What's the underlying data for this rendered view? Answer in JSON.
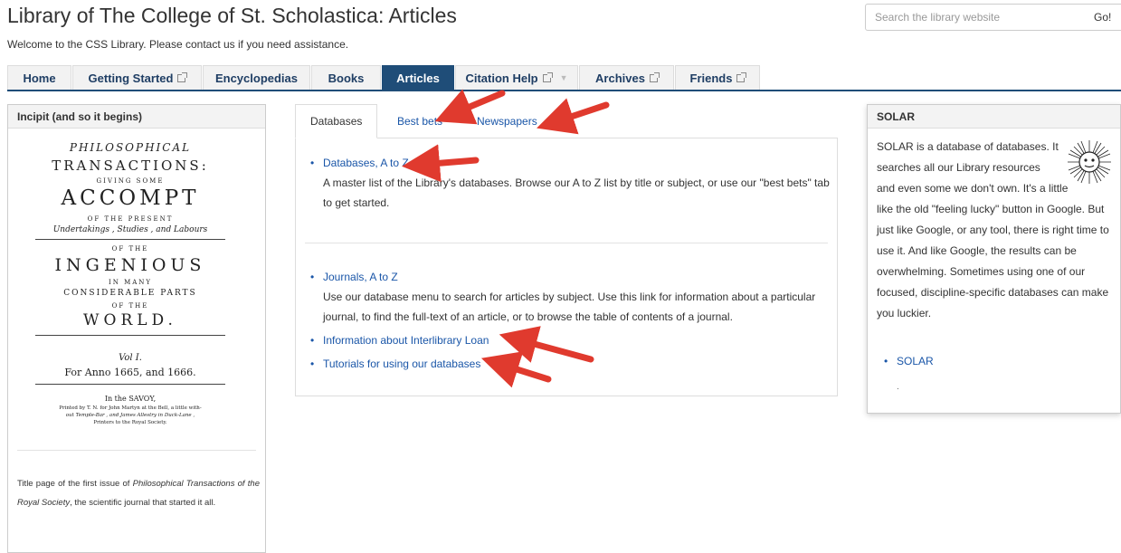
{
  "header": {
    "title": "Library of The College of St. Scholastica: Articles",
    "welcome": "Welcome to the CSS Library. Please contact us if you need assistance.",
    "search_placeholder": "Search the library website",
    "go_label": "Go!"
  },
  "nav": {
    "tabs": [
      {
        "label": "Home"
      },
      {
        "label": "Getting Started"
      },
      {
        "label": "Encyclopedias"
      },
      {
        "label": "Books"
      },
      {
        "label": "Articles"
      },
      {
        "label": "Citation Help"
      },
      {
        "label": "Archives"
      },
      {
        "label": "Friends"
      }
    ],
    "active": "Articles"
  },
  "left": {
    "title": "Incipit (and so it begins)",
    "title_page": {
      "l1": "PHILOSOPHICAL",
      "l2": "TRANSACTIONS:",
      "l3": "GIVING SOME",
      "l4": "ACCOMPT",
      "l5": "OF THE PRESENT",
      "l6": "Undertakings , Studies , and Labours",
      "l7": "OF THE",
      "l8": "INGENIOUS",
      "l9": "IN MANY",
      "l10": "CONSIDERABLE PARTS",
      "l11": "OF THE",
      "l12": "WORLD.",
      "l13": "Vol I.",
      "l14": "For Anno 1665, and 1666.",
      "l15": "In the SAVOY,",
      "l16": "Printed by T. N. for John Martyn at the Bell, a little with-",
      "l17": "out Temple-Bar , and James Allestry in Duck-Lane ,",
      "l18": "Printers to the Royal Society."
    },
    "caption_pre": "Title page of the first issue of ",
    "caption_em": "Philosophical Transactions of the Royal Society",
    "caption_post": ", the scientific journal that started it all."
  },
  "center": {
    "tabs": [
      "Databases",
      "Best bets",
      "Newspapers"
    ],
    "section1": {
      "link": "Databases, A to Z",
      "desc": "A master list of the Library's databases. Browse our A to Z list by title or subject, or use our \"best bets\" tab to get started."
    },
    "section2": {
      "link1": "Journals, A to Z",
      "desc1": "Use our database menu to search for articles by subject. Use this link for information about a particular journal, to find the full-text of an article, or to browse the table of contents of a journal.",
      "link2": "Information about Interlibrary Loan",
      "link3": "Tutorials for using our databases"
    }
  },
  "right": {
    "title": "SOLAR",
    "text": "SOLAR is a database of databases. It searches all our Library resources and even some we don't own. It's a little like the old \"feeling lucky\" button in Google. But just like Google, or any tool, there is right time to use it. And like Google, the results can be overwhelming. Sometimes using one of our focused, discipline-specific databases can make you luckier.",
    "link": "SOLAR",
    "dot": "."
  },
  "colors": {
    "nav_active": "#1f4d78",
    "link": "#1a56a8",
    "arrow": "#e03a2e"
  }
}
